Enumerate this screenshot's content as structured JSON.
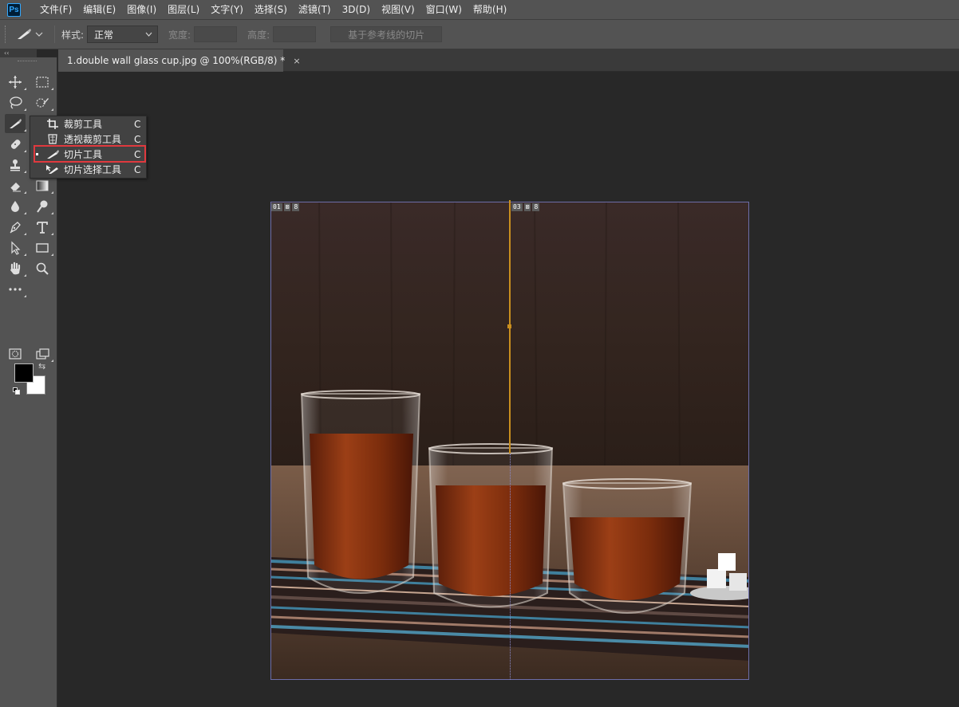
{
  "app": {
    "logo": "Ps"
  },
  "menu": [
    "文件(F)",
    "编辑(E)",
    "图像(I)",
    "图层(L)",
    "文字(Y)",
    "选择(S)",
    "滤镜(T)",
    "3D(D)",
    "视图(V)",
    "窗口(W)",
    "帮助(H)"
  ],
  "options": {
    "style_label": "样式:",
    "style_value": "正常",
    "width_label": "宽度:",
    "height_label": "高度:",
    "guides_button": "基于参考线的切片"
  },
  "document": {
    "tab_title": "1.double wall glass cup.jpg @ 100%(RGB/8) *",
    "close_glyph": "×"
  },
  "flyout": {
    "items": [
      {
        "label": "裁剪工具",
        "shortcut": "C",
        "icon": "crop-icon",
        "selected": false
      },
      {
        "label": "透视裁剪工具",
        "shortcut": "C",
        "icon": "perspective-crop-icon",
        "selected": false
      },
      {
        "label": "切片工具",
        "shortcut": "C",
        "icon": "slice-icon",
        "selected": true
      },
      {
        "label": "切片选择工具",
        "shortcut": "C",
        "icon": "slice-select-icon",
        "selected": false
      }
    ]
  },
  "slices": [
    {
      "number": "01",
      "badge": "8"
    },
    {
      "number": "03",
      "badge": "8"
    }
  ],
  "colors": {
    "foreground": "#000000",
    "background": "#ffffff",
    "highlight": "#e0393e",
    "guide": "#c98f1f",
    "slice_border": "#6d6da8"
  },
  "toolbar_collapse": "‹‹"
}
